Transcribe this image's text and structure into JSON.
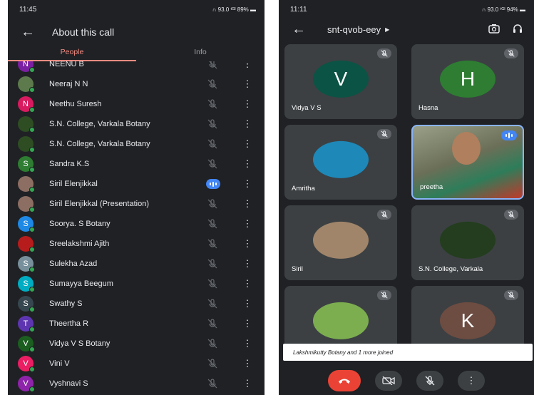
{
  "left": {
    "status": {
      "time": "11:45",
      "right": "∩ 93.0 ᵗᴳᴵ 89% ▬"
    },
    "title": "About this call",
    "tabs": [
      {
        "label": "People"
      },
      {
        "label": "Info"
      }
    ],
    "people": [
      {
        "name": "NEENU B",
        "initial": "N",
        "color": "#7b1fa2",
        "speaking": false
      },
      {
        "name": "Neeraj N N",
        "initial": "",
        "color": "#5d7a4c",
        "speaking": false
      },
      {
        "name": "Neethu Suresh",
        "initial": "N",
        "color": "#d81b60",
        "speaking": false
      },
      {
        "name": "S.N. College, Varkala Botany",
        "initial": "",
        "color": "#2e4d23",
        "speaking": false
      },
      {
        "name": "S.N. College, Varkala Botany",
        "initial": "",
        "color": "#2e4d23",
        "speaking": false
      },
      {
        "name": "Sandra K.S",
        "initial": "S",
        "color": "#2e7d32",
        "speaking": false
      },
      {
        "name": "Siril Elenjikkal",
        "initial": "",
        "color": "#8d6e63",
        "speaking": true
      },
      {
        "name": "Siril Elenjikkal (Presentation)",
        "initial": "",
        "color": "#8d6e63",
        "speaking": false
      },
      {
        "name": "Soorya. S Botany",
        "initial": "S",
        "color": "#1e88e5",
        "speaking": false
      },
      {
        "name": "Sreelakshmi Ajith",
        "initial": "",
        "color": "#b71c1c",
        "speaking": false
      },
      {
        "name": "Sulekha Azad",
        "initial": "S",
        "color": "#78909c",
        "speaking": false
      },
      {
        "name": "Sumayya Beegum",
        "initial": "S",
        "color": "#00acc1",
        "speaking": false
      },
      {
        "name": "Swathy S",
        "initial": "S",
        "color": "#37474f",
        "speaking": false
      },
      {
        "name": "Theertha R",
        "initial": "T",
        "color": "#5e35b1",
        "speaking": false
      },
      {
        "name": "Vidya V S Botany",
        "initial": "V",
        "color": "#1b5e20",
        "speaking": false
      },
      {
        "name": "Vini V",
        "initial": "V",
        "color": "#e91e63",
        "speaking": false
      },
      {
        "name": "Vyshnavi S",
        "initial": "V",
        "color": "#8e24aa",
        "speaking": false
      }
    ]
  },
  "right": {
    "status": {
      "time": "11:11",
      "right": "∩ 93.0 ᵗᴳᴵ 94% ▬"
    },
    "meeting_code": "snt-qvob-eey",
    "tiles": [
      {
        "name": "Vidya V S",
        "initial": "V",
        "color": "#0b5345",
        "kind": "letter",
        "speaking": false
      },
      {
        "name": "Hasna",
        "initial": "H",
        "color": "#2e7d32",
        "kind": "letter",
        "speaking": false
      },
      {
        "name": "Amritha",
        "initial": "",
        "color": "#1e88b8",
        "kind": "photo",
        "speaking": false
      },
      {
        "name": "preetha",
        "initial": "",
        "color": "#8a8f6a",
        "kind": "video",
        "speaking": true
      },
      {
        "name": "Siril",
        "initial": "",
        "color": "#a0856a",
        "kind": "photo",
        "speaking": false
      },
      {
        "name": "S.N. College, Varkala",
        "initial": "",
        "color": "#233d1e",
        "kind": "photo",
        "speaking": false
      },
      {
        "name": "",
        "initial": "",
        "color": "#7cae4f",
        "kind": "photo",
        "speaking": false
      },
      {
        "name": "",
        "initial": "K",
        "color": "#6d4c41",
        "kind": "letter",
        "speaking": false
      }
    ],
    "toast": "Lakshmikutty Botany and 1 more joined"
  }
}
